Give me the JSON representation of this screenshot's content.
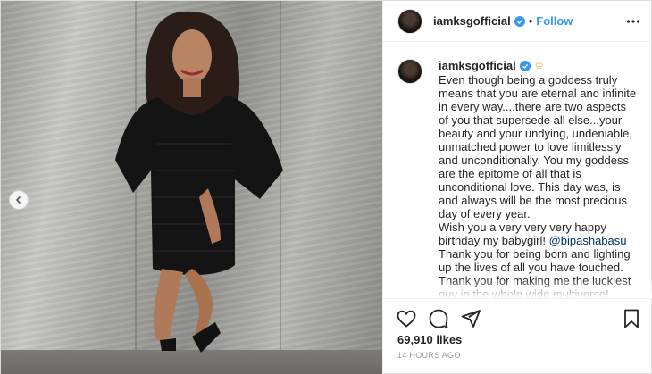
{
  "post": {
    "author": {
      "username": "iamksgofficial",
      "verified_icon": "verified-badge-icon",
      "follow_label": "Follow",
      "separator": "•"
    },
    "caption": {
      "username": "iamksgofficial",
      "emoji_icon": "crown-emoji-icon",
      "text_before_mention": "Even though being a goddess truly means that you are eternal and infinite in every way....there are two aspects of you that supersede all else...your beauty and your undying, undeniable, unmatched power to love limitlessly and unconditionally. You my goddess are the epitome of all that is unconditional love. This day was, is and always will be the most precious day of every year.\nWish you a very very very happy birthday my babygirl! ",
      "mention": "@bipashabasu",
      "text_after_mention": "\nThank you for being born and lighting up the lives of all you have touched. Thank you for making me the luckiest guy in the whole wide multiverse!"
    },
    "likes": "69,910 likes",
    "timestamp": "14 HOURS AGO",
    "icons": {
      "like": "heart-icon",
      "comment": "comment-icon",
      "share": "share-icon",
      "save": "bookmark-icon",
      "more": "more-options-icon",
      "carousel_prev": "chevron-left-icon"
    },
    "colors": {
      "accent": "#3897f0",
      "text": "#262626",
      "muted": "#999999",
      "mention": "#003569",
      "border": "#dbdbdb"
    }
  }
}
